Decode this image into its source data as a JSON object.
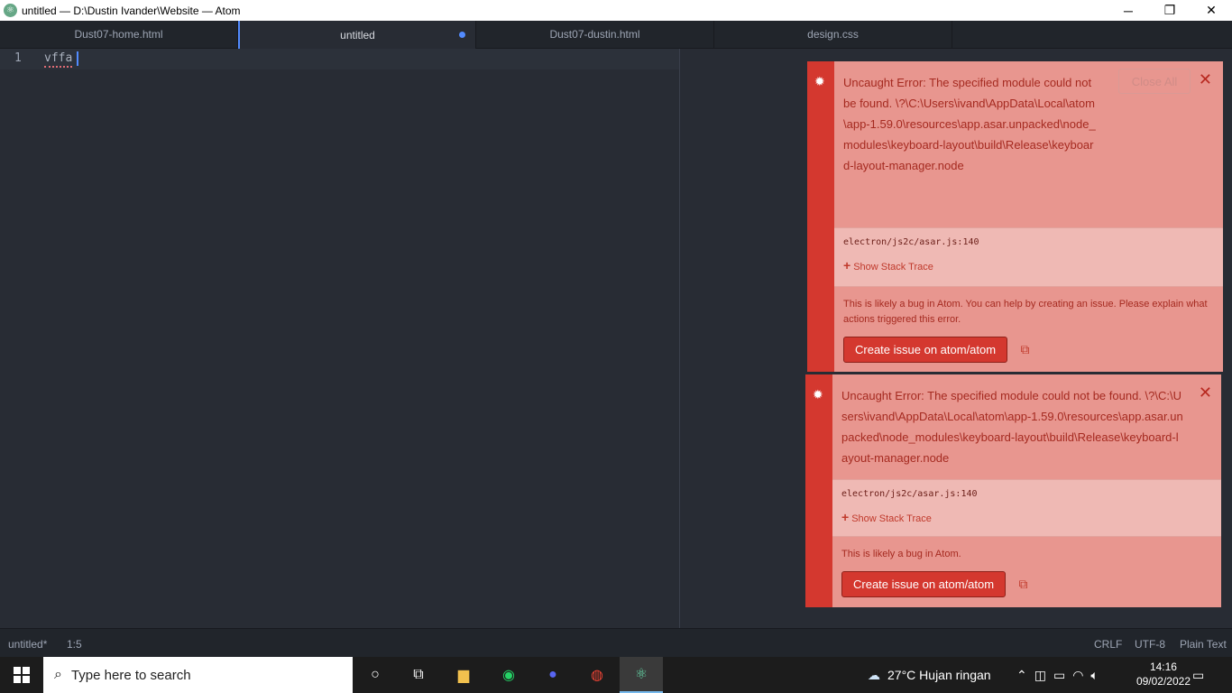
{
  "window": {
    "title": "untitled — D:\\Dustin Ivander\\Website — Atom",
    "minimize": "─",
    "restore": "❐",
    "close": "✕"
  },
  "tabs": [
    {
      "label": "Dust07-home.html"
    },
    {
      "label": "untitled"
    },
    {
      "label": "Dust07-dustin.html"
    },
    {
      "label": "design.css"
    }
  ],
  "editor": {
    "line_number": "1",
    "content": "vffa"
  },
  "notifications": [
    {
      "message": "Uncaught Error: The specified module could not be found. \\?\\C:\\Users\\ivand\\AppData\\Local\\atom\\app-1.59.0\\resources\\app.asar.unpacked\\node_modules\\keyboard-layout\\build\\Release\\keyboard-layout-manager.node",
      "close_all": "Close All",
      "location": "electron/js2c/asar.js:140",
      "stack_trace": "Show Stack Trace",
      "description": "This is likely a bug in Atom. You can help by creating an issue. Please explain what actions triggered this error.",
      "button": "Create issue on atom/atom"
    },
    {
      "message": "Uncaught Error: The specified module could not be found. \\?\\C:\\Users\\ivand\\AppData\\Local\\atom\\app-1.59.0\\resources\\app.asar.unpacked\\node_modules\\keyboard-layout\\build\\Release\\keyboard-layout-manager.node",
      "location": "electron/js2c/asar.js:140",
      "stack_trace": "Show Stack Trace",
      "description": "This is likely a bug in Atom.",
      "button": "Create issue on atom/atom"
    }
  ],
  "statusbar": {
    "file": "untitled*",
    "position": "1:5",
    "line_ending": "CRLF",
    "encoding": "UTF-8",
    "grammar": "Plain Text"
  },
  "taskbar": {
    "search_placeholder": "Type here to search",
    "weather": "27°C  Hujan ringan",
    "time": "14:16",
    "date": "09/02/2022"
  }
}
